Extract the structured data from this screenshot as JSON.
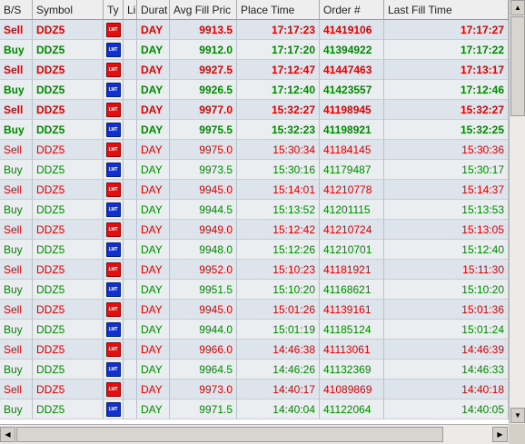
{
  "columns": [
    {
      "key": "bs",
      "label": "B/S",
      "align": "l"
    },
    {
      "key": "symbol",
      "label": "Symbol",
      "align": "l"
    },
    {
      "key": "type",
      "label": "Ty",
      "align": "c"
    },
    {
      "key": "li",
      "label": "Li",
      "align": "l"
    },
    {
      "key": "duration",
      "label": "Durat",
      "align": "l"
    },
    {
      "key": "avg",
      "label": "Avg Fill Pric",
      "align": "r"
    },
    {
      "key": "place",
      "label": "Place Time",
      "align": "r"
    },
    {
      "key": "order",
      "label": "Order #",
      "align": "l"
    },
    {
      "key": "last",
      "label": "Last Fill Time",
      "align": "r"
    }
  ],
  "icons": {
    "order_type": "lmt-order-icon",
    "icon_text": "LMT"
  },
  "colors": {
    "sell": "#e00000",
    "buy": "#008800"
  },
  "rows": [
    {
      "bs": "Sell",
      "symbol": "DDZ5",
      "duration": "DAY",
      "avg": "9913.5",
      "place": "17:17:23",
      "order": "41419106",
      "last": "17:17:27",
      "bold": true
    },
    {
      "bs": "Buy",
      "symbol": "DDZ5",
      "duration": "DAY",
      "avg": "9912.0",
      "place": "17:17:20",
      "order": "41394922",
      "last": "17:17:22",
      "bold": true
    },
    {
      "bs": "Sell",
      "symbol": "DDZ5",
      "duration": "DAY",
      "avg": "9927.5",
      "place": "17:12:47",
      "order": "41447463",
      "last": "17:13:17",
      "bold": true
    },
    {
      "bs": "Buy",
      "symbol": "DDZ5",
      "duration": "DAY",
      "avg": "9926.5",
      "place": "17:12:40",
      "order": "41423557",
      "last": "17:12:46",
      "bold": true
    },
    {
      "bs": "Sell",
      "symbol": "DDZ5",
      "duration": "DAY",
      "avg": "9977.0",
      "place": "15:32:27",
      "order": "41198945",
      "last": "15:32:27",
      "bold": true
    },
    {
      "bs": "Buy",
      "symbol": "DDZ5",
      "duration": "DAY",
      "avg": "9975.5",
      "place": "15:32:23",
      "order": "41198921",
      "last": "15:32:25",
      "bold": true
    },
    {
      "bs": "Sell",
      "symbol": "DDZ5",
      "duration": "DAY",
      "avg": "9975.0",
      "place": "15:30:34",
      "order": "41184145",
      "last": "15:30:36",
      "bold": false
    },
    {
      "bs": "Buy",
      "symbol": "DDZ5",
      "duration": "DAY",
      "avg": "9973.5",
      "place": "15:30:16",
      "order": "41179487",
      "last": "15:30:17",
      "bold": false
    },
    {
      "bs": "Sell",
      "symbol": "DDZ5",
      "duration": "DAY",
      "avg": "9945.0",
      "place": "15:14:01",
      "order": "41210778",
      "last": "15:14:37",
      "bold": false
    },
    {
      "bs": "Buy",
      "symbol": "DDZ5",
      "duration": "DAY",
      "avg": "9944.5",
      "place": "15:13:52",
      "order": "41201115",
      "last": "15:13:53",
      "bold": false
    },
    {
      "bs": "Sell",
      "symbol": "DDZ5",
      "duration": "DAY",
      "avg": "9949.0",
      "place": "15:12:42",
      "order": "41210724",
      "last": "15:13:05",
      "bold": false
    },
    {
      "bs": "Buy",
      "symbol": "DDZ5",
      "duration": "DAY",
      "avg": "9948.0",
      "place": "15:12:26",
      "order": "41210701",
      "last": "15:12:40",
      "bold": false
    },
    {
      "bs": "Sell",
      "symbol": "DDZ5",
      "duration": "DAY",
      "avg": "9952.0",
      "place": "15:10:23",
      "order": "41181921",
      "last": "15:11:30",
      "bold": false
    },
    {
      "bs": "Buy",
      "symbol": "DDZ5",
      "duration": "DAY",
      "avg": "9951.5",
      "place": "15:10:20",
      "order": "41168621",
      "last": "15:10:20",
      "bold": false
    },
    {
      "bs": "Sell",
      "symbol": "DDZ5",
      "duration": "DAY",
      "avg": "9945.0",
      "place": "15:01:26",
      "order": "41139161",
      "last": "15:01:36",
      "bold": false
    },
    {
      "bs": "Buy",
      "symbol": "DDZ5",
      "duration": "DAY",
      "avg": "9944.0",
      "place": "15:01:19",
      "order": "41185124",
      "last": "15:01:24",
      "bold": false
    },
    {
      "bs": "Sell",
      "symbol": "DDZ5",
      "duration": "DAY",
      "avg": "9966.0",
      "place": "14:46:38",
      "order": "41113061",
      "last": "14:46:39",
      "bold": false
    },
    {
      "bs": "Buy",
      "symbol": "DDZ5",
      "duration": "DAY",
      "avg": "9964.5",
      "place": "14:46:26",
      "order": "41132369",
      "last": "14:46:33",
      "bold": false
    },
    {
      "bs": "Sell",
      "symbol": "DDZ5",
      "duration": "DAY",
      "avg": "9973.0",
      "place": "14:40:17",
      "order": "41089869",
      "last": "14:40:18",
      "bold": false
    },
    {
      "bs": "Buy",
      "symbol": "DDZ5",
      "duration": "DAY",
      "avg": "9971.5",
      "place": "14:40:04",
      "order": "41122064",
      "last": "14:40:05",
      "bold": false
    }
  ]
}
